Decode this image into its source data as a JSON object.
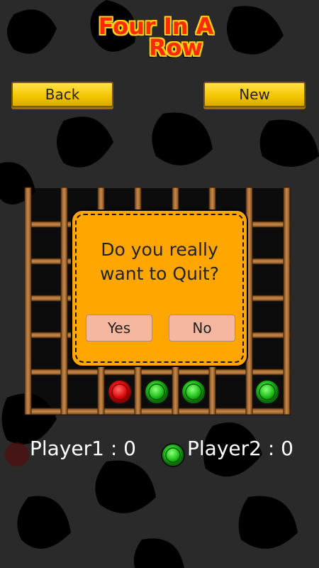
{
  "title": {
    "line1": "Four In A",
    "line2": "Row"
  },
  "toolbar": {
    "back_label": "Back",
    "new_label": "New"
  },
  "dialog": {
    "line1": "Do you really",
    "line2": "want to Quit?",
    "yes_label": "Yes",
    "no_label": "No"
  },
  "score": {
    "player1_label": "Player1 : 0",
    "player2_label": "Player2 : 0"
  },
  "colors": {
    "player1": "#e01010",
    "player2": "#22c41c",
    "dialog": "#ffa600",
    "button": "#f4c400"
  },
  "board": {
    "bottom_row": [
      "empty",
      "empty",
      "red",
      "green",
      "green",
      "empty",
      "green"
    ]
  }
}
